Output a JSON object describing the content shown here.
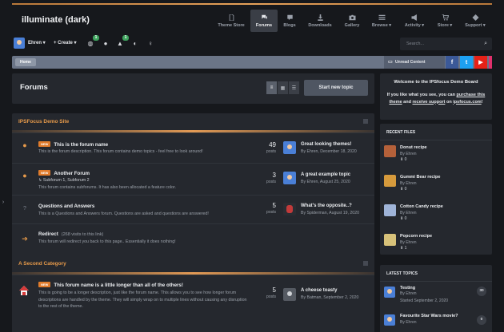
{
  "header": {
    "logo": "illuminate (dark)",
    "nav": [
      {
        "label": "Theme Store",
        "icon": "document-icon"
      },
      {
        "label": "Forums",
        "icon": "comments-icon",
        "active": true
      },
      {
        "label": "Blogs",
        "icon": "blog-icon"
      },
      {
        "label": "Downloads",
        "icon": "download-icon"
      },
      {
        "label": "Gallery",
        "icon": "camera-icon"
      },
      {
        "label": "Browse",
        "icon": "list-icon"
      },
      {
        "label": "Activity",
        "icon": "megaphone-icon"
      },
      {
        "label": "Store",
        "icon": "cart-icon"
      },
      {
        "label": "Support",
        "icon": "help-icon"
      }
    ]
  },
  "userbar": {
    "username": "Ehren",
    "create_label": "Create",
    "notification_count": "1",
    "reports_count": "1",
    "search_placeholder": "Search..."
  },
  "breadcrumb": {
    "home": "Home",
    "unread": "Unread Content"
  },
  "social": {
    "facebook": "f",
    "twitter": "t",
    "youtube": "▶",
    "instagram": "◎"
  },
  "page": {
    "title": "Forums",
    "start_topic": "Start new topic"
  },
  "categories": [
    {
      "title": "IPSFocus Demo Site",
      "forums": [
        {
          "new_badge": "NEW",
          "title": "This is the forum name",
          "desc": "This is the forum description. This forum contains demo topics - feel free to look around!",
          "count": "49",
          "count_label": "posts",
          "last_title": "Great looking themes!",
          "last_meta": "By Ehren, December 18, 2020"
        },
        {
          "new_badge": "NEW",
          "title": "Another Forum",
          "subforums": "Subforum 1, Subforum 2",
          "desc": "This forum contains subforums. It has also been allocated a feature color.",
          "count": "3",
          "count_label": "posts",
          "last_title": "A great example topic",
          "last_meta": "By Ehren, August 25, 2020"
        },
        {
          "title": "Questions and Answers",
          "desc": "This is a Questions and Answers forum. Questions are asked and questions are answered!",
          "count": "5",
          "count_label": "posts",
          "last_title": "What's the opposite..?",
          "last_meta": "By Spiderman, August 19, 2020"
        },
        {
          "title": "Redirect",
          "redirects": "(268 visits to this link)",
          "desc": "This forum will redirect you back to this page.. Essentially it does nothing!"
        }
      ]
    },
    {
      "title": "A Second Category",
      "forums": [
        {
          "new_badge": "NEW",
          "title": "This forum name is a little longer than all of the others!",
          "desc": "This is going to be a longer description, just like the forum name. This allows you to see how longer forum descriptions are handled by the theme. They will simply wrap on to multiple lines without causing any disruption to the rest of the theme.",
          "count": "5",
          "count_label": "posts",
          "last_title": "A cheese toasty",
          "last_meta": "By Batman, September 2, 2020"
        }
      ]
    }
  ],
  "sidebar": {
    "welcome": {
      "title": "Welcome to the IPSfocus Demo Board",
      "line1": "If you like what you see, you can",
      "link1": "purchase this theme",
      "line2": "and",
      "link2": "receive support",
      "line3": "on",
      "link3": "ipsfocus.com",
      "end": "!"
    },
    "recent_files": {
      "title": "RECENT FILES",
      "items": [
        {
          "title": "Donut recipe",
          "by": "By Ehren",
          "downloads": "0",
          "thumb_color": "#b5613a"
        },
        {
          "title": "Gummi Bear recipe",
          "by": "By Ehren",
          "downloads": "0",
          "thumb_color": "#d69a3c"
        },
        {
          "title": "Cotton Candy recipe",
          "by": "By Ehren",
          "downloads": "0",
          "thumb_color": "#9fb4d8"
        },
        {
          "title": "Popcorn recipe",
          "by": "By Ehren",
          "downloads": "1",
          "thumb_color": "#d8c27a"
        }
      ]
    },
    "latest_topics": {
      "title": "LATEST TOPICS",
      "items": [
        {
          "title": "Testing",
          "by": "By Ehren",
          "date": "Started September 2, 2020",
          "replies": "30"
        },
        {
          "title": "Favourite Star Wars movie?",
          "by": "By Ehren",
          "date": "",
          "replies": "0"
        }
      ]
    }
  },
  "colors": {
    "accent": "#e79a4a",
    "breadcrumb_bar": "#6b7587",
    "facebook": "#3b5998",
    "twitter": "#1da1f2",
    "youtube": "#e62117",
    "instagram": "#e1306c"
  }
}
